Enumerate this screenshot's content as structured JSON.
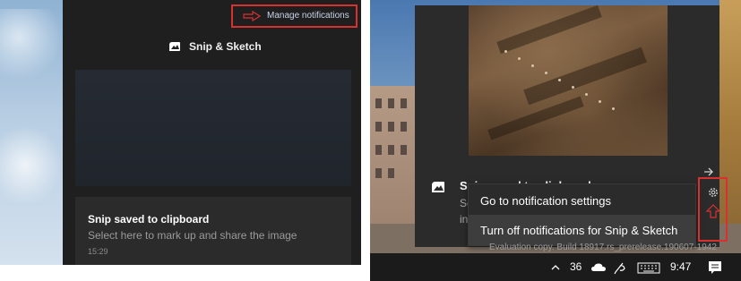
{
  "left": {
    "manage_notifications": "Manage notifications",
    "app_name": "Snip & Sketch",
    "notification": {
      "title": "Snip saved to clipboard",
      "body": "Select here to mark up and share the image",
      "time": "15:29"
    }
  },
  "right": {
    "toast": {
      "title": "Snip saved to clipboard",
      "body_line1": "Se",
      "body_line2": "in"
    },
    "context_menu": {
      "items": [
        "Go to notification settings",
        "Turn off notifications for Snip & Sketch"
      ]
    },
    "watermark": "Evaluation copy. Build 18917.rs_prerelease.190607-1942",
    "taskbar": {
      "temperature": "36",
      "time": "9:47"
    }
  },
  "colors": {
    "highlight_red": "#d93030",
    "action_center_bg": "#1f1f1f",
    "card_bg": "#2b2b2b",
    "link_text": "#c8d4e8"
  },
  "icons": [
    "right-arrow-icon",
    "snip-sketch-icon",
    "gear-icon",
    "up-arrow-icon",
    "chevron-up-icon",
    "cloud-icon",
    "pen-icon",
    "keyboard-icon",
    "notification-icon"
  ]
}
